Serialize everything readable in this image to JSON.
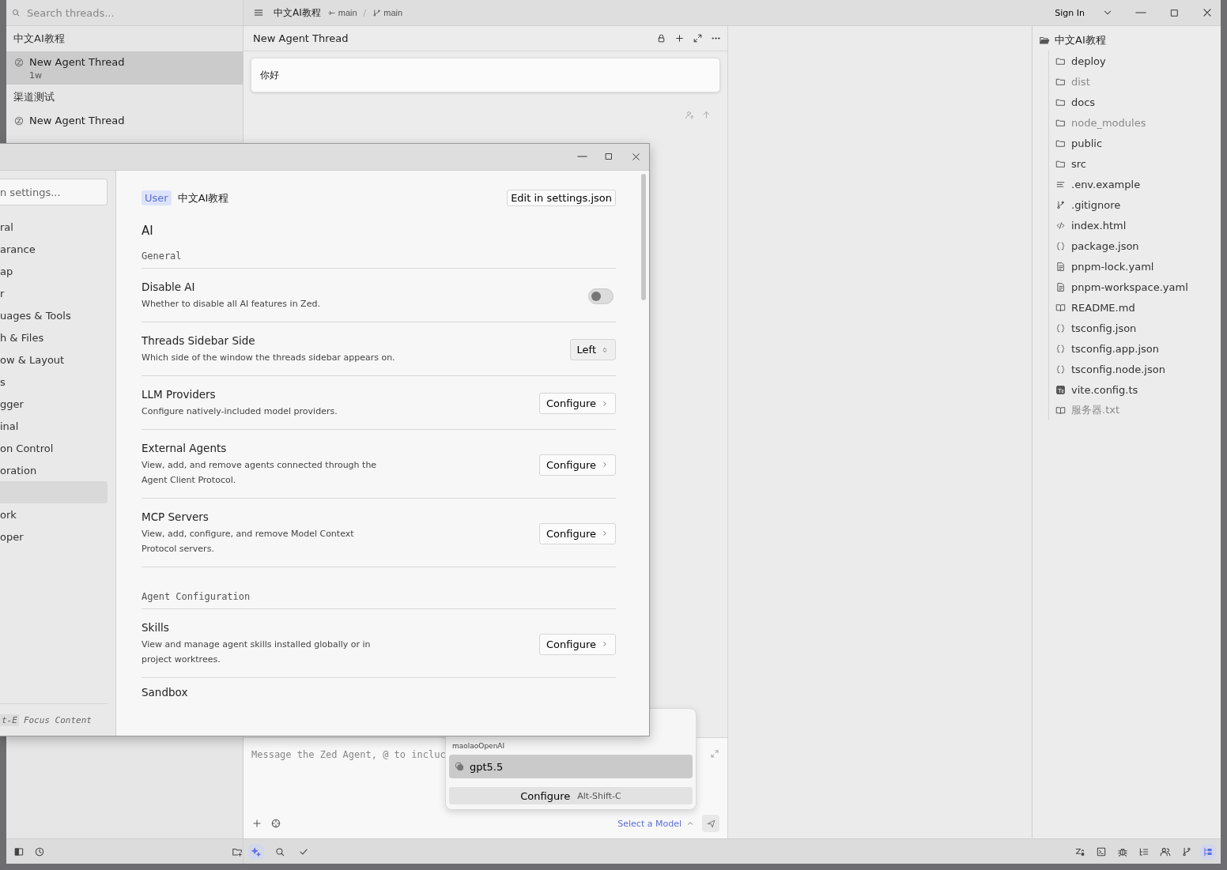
{
  "title_bar": {
    "project": "中文AI教程",
    "worktree_branch": "main",
    "separator": "/",
    "branch": "main",
    "sign_in": "Sign In"
  },
  "threads_sidebar": {
    "search_placeholder": "Search threads...",
    "groups": [
      {
        "title": "中文AI教程",
        "threads": [
          {
            "title": "New Agent Thread",
            "age": "1w",
            "selected": true
          }
        ]
      },
      {
        "title": "渠道测试",
        "threads": [
          {
            "title": "New Agent Thread",
            "selected": false
          }
        ]
      }
    ]
  },
  "agent_panel": {
    "title": "New Agent Thread",
    "messages": [
      {
        "text": "你好"
      }
    ],
    "composer_placeholder": "Message the Zed Agent, @ to incluc",
    "model_link": "Select a Model"
  },
  "model_menu": {
    "provider": "maolaoOpenAI",
    "models": [
      {
        "name": "gpt5.5",
        "selected": true
      }
    ],
    "configure": {
      "label": "Configure",
      "shortcut": "Alt-Shift-C"
    }
  },
  "project_panel": {
    "root": {
      "name": "中文AI教程",
      "expanded": true,
      "children": [
        {
          "name": "deploy",
          "kind": "folder",
          "ignored": false
        },
        {
          "name": "dist",
          "kind": "folder",
          "ignored": true
        },
        {
          "name": "docs",
          "kind": "folder",
          "ignored": false
        },
        {
          "name": "node_modules",
          "kind": "folder",
          "ignored": true
        },
        {
          "name": "public",
          "kind": "folder",
          "ignored": false
        },
        {
          "name": "src",
          "kind": "folder",
          "ignored": false
        },
        {
          "name": ".env.example",
          "kind": "text",
          "ignored": false
        },
        {
          "name": ".gitignore",
          "kind": "git",
          "ignored": false
        },
        {
          "name": "index.html",
          "kind": "html",
          "ignored": false
        },
        {
          "name": "package.json",
          "kind": "json",
          "ignored": false
        },
        {
          "name": "pnpm-lock.yaml",
          "kind": "yaml",
          "ignored": false
        },
        {
          "name": "pnpm-workspace.yaml",
          "kind": "yaml",
          "ignored": false
        },
        {
          "name": "README.md",
          "kind": "book",
          "ignored": false
        },
        {
          "name": "tsconfig.json",
          "kind": "json",
          "ignored": false
        },
        {
          "name": "tsconfig.app.json",
          "kind": "json",
          "ignored": false
        },
        {
          "name": "tsconfig.node.json",
          "kind": "json",
          "ignored": false
        },
        {
          "name": "vite.config.ts",
          "kind": "ts",
          "ignored": false
        },
        {
          "name": "服务器.txt",
          "kind": "book",
          "ignored": true
        }
      ]
    }
  },
  "settings_window": {
    "search_placeholder": "n settings...",
    "nav": [
      {
        "label": "ral",
        "selected": false
      },
      {
        "label": "arance",
        "selected": false
      },
      {
        "label": "ap",
        "selected": false
      },
      {
        "label": "r",
        "selected": false
      },
      {
        "label": "uages & Tools",
        "selected": false
      },
      {
        "label": "h & Files",
        "selected": false
      },
      {
        "label": "ow & Layout",
        "selected": false
      },
      {
        "label": "s",
        "selected": false
      },
      {
        "label": "gger",
        "selected": false
      },
      {
        "label": "inal",
        "selected": false
      },
      {
        "label": "on Control",
        "selected": false
      },
      {
        "label": "oration",
        "selected": false
      },
      {
        "selected": true
      },
      {
        "label": "ork",
        "selected": false
      },
      {
        "label": "oper",
        "selected": false
      }
    ],
    "footer": {
      "key": "t-E",
      "label": "Focus Content"
    },
    "scope": "User",
    "project": "中文AI教程",
    "edit_button": "Edit in settings.json",
    "page_title": "AI",
    "sections": [
      {
        "title": "General",
        "items": [
          {
            "kind": "toggle",
            "title": "Disable AI",
            "description": "Whether to disable all AI features in Zed.",
            "on": false
          },
          {
            "kind": "dropdown",
            "title": "Threads Sidebar Side",
            "description": "Which side of the window the threads sidebar appears on.",
            "value": "Left"
          },
          {
            "kind": "button",
            "title": "LLM Providers",
            "description": "Configure natively-included model providers.",
            "button": "Configure"
          },
          {
            "kind": "button",
            "title": "External Agents",
            "description": "View, add, and remove agents connected through the Agent Client Protocol.",
            "button": "Configure"
          },
          {
            "kind": "button",
            "title": "MCP Servers",
            "description": "View, add, configure, and remove Model Context Protocol servers.",
            "button": "Configure"
          }
        ]
      },
      {
        "title": "Agent Configuration",
        "items": [
          {
            "kind": "button",
            "title": "Skills",
            "description": "View and manage agent skills installed globally or in project worktrees.",
            "button": "Configure"
          },
          {
            "kind": "partial",
            "title": "Sandbox"
          }
        ]
      }
    ]
  },
  "status_bar": {
    "left": [
      {
        "kind": "panel",
        "active": false
      },
      {
        "kind": "history",
        "active": false
      },
      {
        "kind": "new-folder",
        "active": false
      }
    ],
    "center": [
      {
        "kind": "sparkle",
        "active": true
      },
      {
        "kind": "search",
        "active": false
      },
      {
        "kind": "check",
        "active": false
      }
    ],
    "right": [
      {
        "kind": "zed",
        "active": false
      },
      {
        "kind": "terminal",
        "active": false
      },
      {
        "kind": "bug",
        "active": false
      },
      {
        "kind": "outline",
        "active": false
      },
      {
        "kind": "users",
        "active": false
      },
      {
        "kind": "git",
        "active": false
      },
      {
        "kind": "tree",
        "active": true
      }
    ]
  }
}
